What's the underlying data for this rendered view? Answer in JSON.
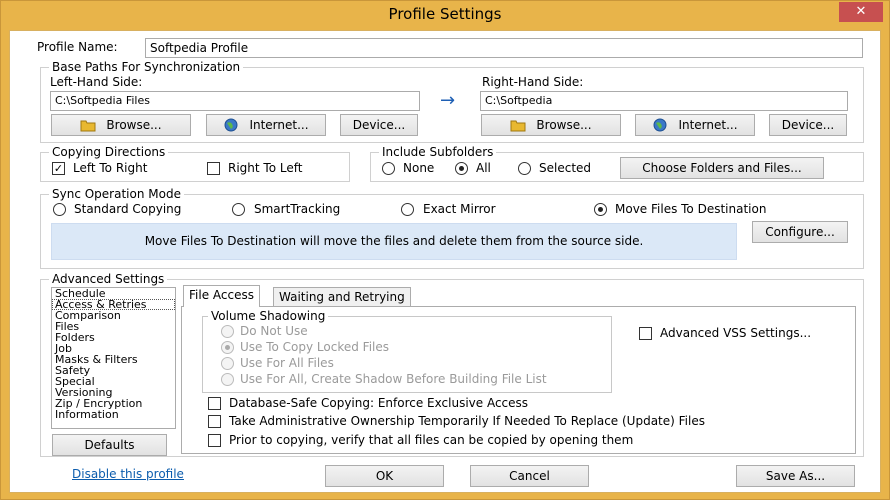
{
  "window": {
    "title": "Profile Settings",
    "close_glyph": "✕"
  },
  "profile": {
    "label": "Profile Name:",
    "value": "Softpedia Profile"
  },
  "base_paths": {
    "title": "Base Paths For Synchronization",
    "left_label": "Left-Hand Side:",
    "left_value": "C:\\Softpedia Files",
    "right_label": "Right-Hand Side:",
    "right_value": "C:\\Softpedia",
    "arrow": "→",
    "browse_label": "Browse...",
    "internet_label": "Internet...",
    "device_label": "Device..."
  },
  "copying_directions": {
    "title": "Copying Directions",
    "left_to_right": {
      "label": "Left To Right",
      "checked": true
    },
    "right_to_left": {
      "label": "Right To Left",
      "checked": false
    }
  },
  "include_subfolders": {
    "title": "Include Subfolders",
    "none_label": "None",
    "all_label": "All",
    "selected_label": "Selected",
    "selected_value": "All",
    "choose_button": "Choose Folders and Files..."
  },
  "sync_mode": {
    "title": "Sync Operation Mode",
    "options": [
      "Standard Copying",
      "SmartTracking",
      "Exact Mirror",
      "Move Files To Destination"
    ],
    "selected": "Move Files To Destination",
    "description": "Move Files To Destination will move the files and delete them from the source side.",
    "configure_button": "Configure..."
  },
  "advanced": {
    "title": "Advanced Settings",
    "list_items": [
      "Schedule",
      "Access & Retries",
      "Comparison",
      "Files",
      "Folders",
      "Job",
      "Masks & Filters",
      "Safety",
      "Special",
      "Versioning",
      "Zip / Encryption",
      "Information"
    ],
    "selected_item": "Access & Retries",
    "defaults_button": "Defaults",
    "tabs": [
      "File Access",
      "Waiting and Retrying"
    ],
    "active_tab": "File Access",
    "volume_shadowing": {
      "title": "Volume Shadowing",
      "options": [
        "Do Not Use",
        "Use To Copy Locked Files",
        "Use For All Files",
        "Use For All, Create Shadow Before Building File List"
      ],
      "selected": "Use To Copy Locked Files",
      "enabled": false
    },
    "advanced_vss": {
      "label": "Advanced VSS Settings...",
      "checked": false
    },
    "checkboxes": [
      {
        "label": "Database-Safe Copying: Enforce Exclusive Access",
        "checked": false
      },
      {
        "label": "Take Administrative Ownership Temporarily If Needed To Replace (Update) Files",
        "checked": false
      },
      {
        "label": "Prior to copying, verify that all files can be copied by opening them",
        "checked": false
      }
    ]
  },
  "footer": {
    "disable_link": "Disable this profile",
    "ok_button": "OK",
    "cancel_button": "Cancel",
    "save_as_button": "Save As..."
  },
  "colors": {
    "frame": "#e8b44a",
    "info_bg": "#dbe8f7",
    "link": "#0b5cad",
    "close": "#c75050",
    "arrow": "#1e5fb4"
  }
}
